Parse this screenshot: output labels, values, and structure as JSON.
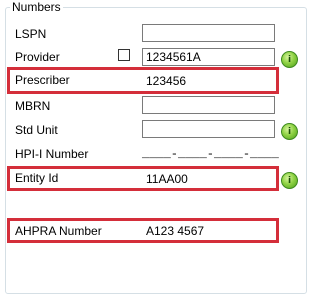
{
  "group": {
    "title": "Numbers"
  },
  "fields": {
    "lspn": {
      "label": "LSPN",
      "value": ""
    },
    "provider": {
      "label": "Provider",
      "value": "1234561A",
      "checked": false
    },
    "prescriber": {
      "label": "Prescriber",
      "value": "123456"
    },
    "mbrn": {
      "label": "MBRN",
      "value": ""
    },
    "std_unit": {
      "label": "Std Unit",
      "value": ""
    },
    "hpi_i": {
      "label": "HPI-I Number",
      "value": "____-____-____-____"
    },
    "entity_id": {
      "label": "Entity Id",
      "value": "11AA00"
    },
    "ahpra": {
      "label": "AHPRA Number",
      "value": "A123 4567"
    }
  },
  "buttons": {
    "lookup_glyph": "i"
  },
  "colors": {
    "highlight": "#d42e3a",
    "button": "#8fd244"
  }
}
